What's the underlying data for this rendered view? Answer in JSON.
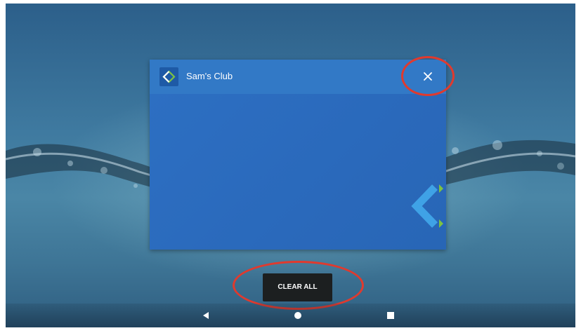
{
  "task_card": {
    "app_name": "Sam's Club",
    "app_icon": "sams-club-diamond-icon",
    "close_icon": "close-icon",
    "colors": {
      "header": "#3279c6",
      "body": "#2a6dc0",
      "logo_blue": "#3fa2e6",
      "logo_green": "#7ec242"
    }
  },
  "clear_all": {
    "label": "CLEAR ALL"
  },
  "annotations": {
    "color": "#e03a2e"
  },
  "navigation_bar": {
    "back_icon": "back-triangle-icon",
    "home_icon": "home-circle-icon",
    "recents_icon": "recents-square-icon"
  }
}
